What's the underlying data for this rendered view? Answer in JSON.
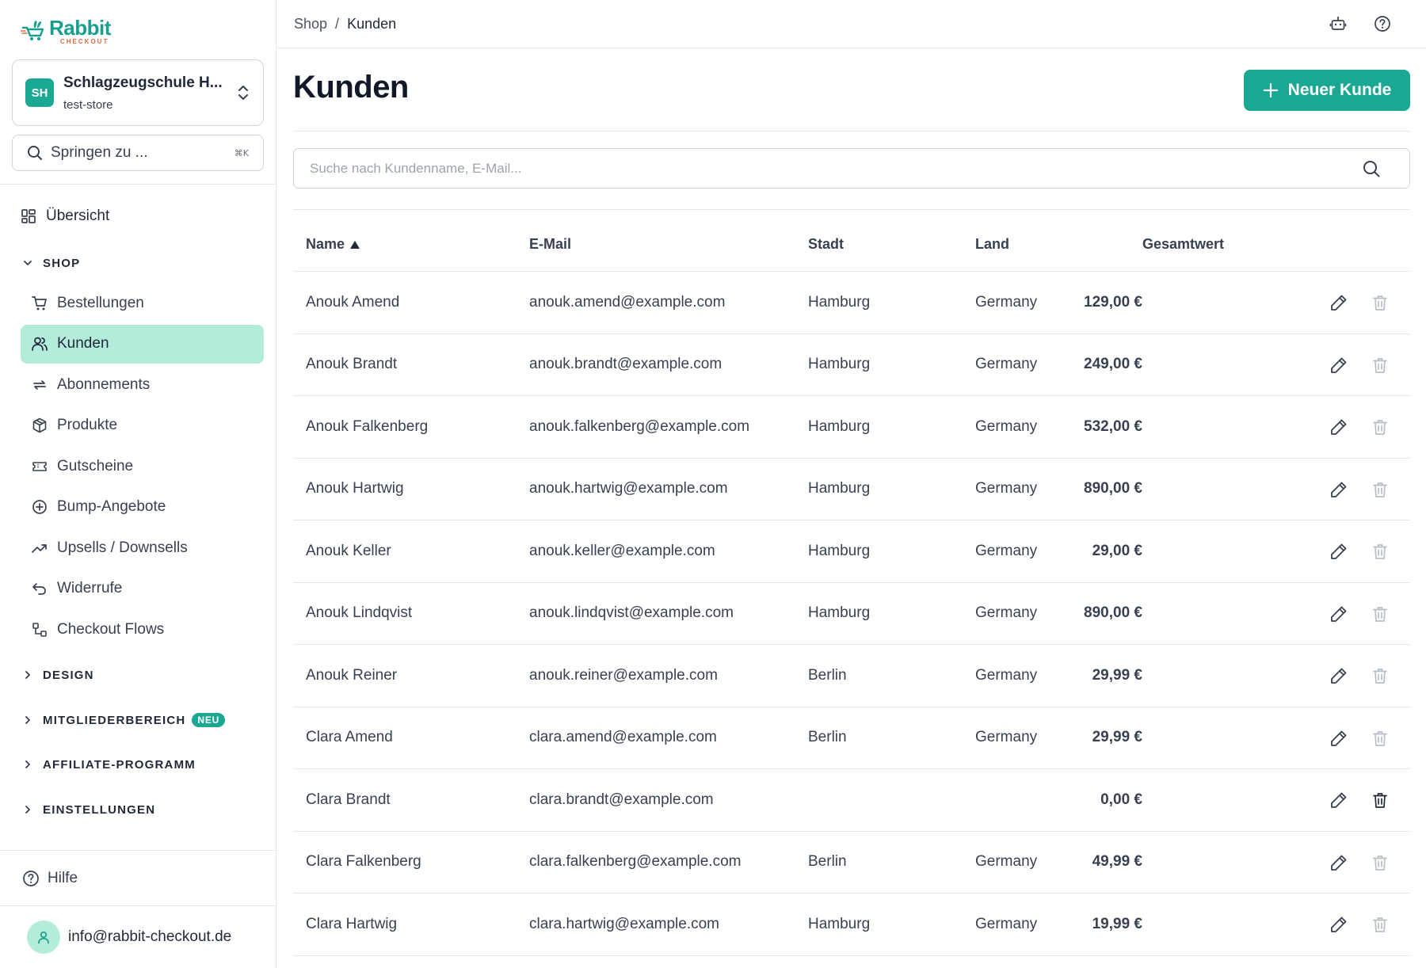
{
  "brand": {
    "name": "Rabbit",
    "tagline": "CHECKOUT",
    "primary_color": "#1aa893",
    "accent_color": "#e26a3b"
  },
  "store": {
    "initials": "SH",
    "name": "Schlagzeugschule H...",
    "slug": "test-store"
  },
  "jump": {
    "placeholder": "Springen zu ...",
    "shortcut": "⌘K"
  },
  "nav": {
    "overview": {
      "label": "Übersicht",
      "icon": "grid-icon"
    },
    "sections": {
      "shop": "SHOP",
      "design": "DESIGN",
      "members": "MITGLIEDERBEREICH",
      "members_badge": "NEU",
      "affiliate": "AFFILIATE-PROGRAMM",
      "settings": "EINSTELLUNGEN"
    },
    "shop_items": [
      {
        "label": "Bestellungen",
        "icon": "cart-icon"
      },
      {
        "label": "Kunden",
        "icon": "users-icon",
        "active": true
      },
      {
        "label": "Abonnements",
        "icon": "repeat-icon"
      },
      {
        "label": "Produkte",
        "icon": "box-icon"
      },
      {
        "label": "Gutscheine",
        "icon": "ticket-icon"
      },
      {
        "label": "Bump-Angebote",
        "icon": "plus-circle-icon"
      },
      {
        "label": "Upsells / Downsells",
        "icon": "trending-icon"
      },
      {
        "label": "Widerrufe",
        "icon": "undo-icon"
      },
      {
        "label": "Checkout Flows",
        "icon": "flow-icon"
      }
    ],
    "help": "Hilfe",
    "user_email": "info@rabbit-checkout.de"
  },
  "breadcrumb": {
    "root": "Shop",
    "separator": "/",
    "current": "Kunden"
  },
  "page": {
    "title": "Kunden",
    "new_button": "Neuer Kunde"
  },
  "search": {
    "placeholder": "Suche nach Kundenname, E-Mail..."
  },
  "table": {
    "headers": {
      "name": "Name",
      "email": "E-Mail",
      "city": "Stadt",
      "country": "Land",
      "total": "Gesamtwert"
    },
    "sort": {
      "column": "name",
      "direction": "asc"
    },
    "rows": [
      {
        "name": "Anouk Amend",
        "email": "anouk.amend@example.com",
        "city": "Hamburg",
        "country": "Germany",
        "total": "129,00 €"
      },
      {
        "name": "Anouk Brandt",
        "email": "anouk.brandt@example.com",
        "city": "Hamburg",
        "country": "Germany",
        "total": "249,00 €"
      },
      {
        "name": "Anouk Falkenberg",
        "email": "anouk.falkenberg@example.com",
        "city": "Hamburg",
        "country": "Germany",
        "total": "532,00 €"
      },
      {
        "name": "Anouk Hartwig",
        "email": "anouk.hartwig@example.com",
        "city": "Hamburg",
        "country": "Germany",
        "total": "890,00 €"
      },
      {
        "name": "Anouk Keller",
        "email": "anouk.keller@example.com",
        "city": "Hamburg",
        "country": "Germany",
        "total": "29,00 €"
      },
      {
        "name": "Anouk Lindqvist",
        "email": "anouk.lindqvist@example.com",
        "city": "Hamburg",
        "country": "Germany",
        "total": "890,00 €"
      },
      {
        "name": "Anouk Reiner",
        "email": "anouk.reiner@example.com",
        "city": "Berlin",
        "country": "Germany",
        "total": "29,99 €"
      },
      {
        "name": "Clara Amend",
        "email": "clara.amend@example.com",
        "city": "Berlin",
        "country": "Germany",
        "total": "29,99 €"
      },
      {
        "name": "Clara Brandt",
        "email": "clara.brandt@example.com",
        "city": "",
        "country": "",
        "total": "0,00 €"
      },
      {
        "name": "Clara Falkenberg",
        "email": "clara.falkenberg@example.com",
        "city": "Berlin",
        "country": "Germany",
        "total": "49,99 €"
      },
      {
        "name": "Clara Hartwig",
        "email": "clara.hartwig@example.com",
        "city": "Hamburg",
        "country": "Germany",
        "total": "19,99 €"
      }
    ]
  }
}
